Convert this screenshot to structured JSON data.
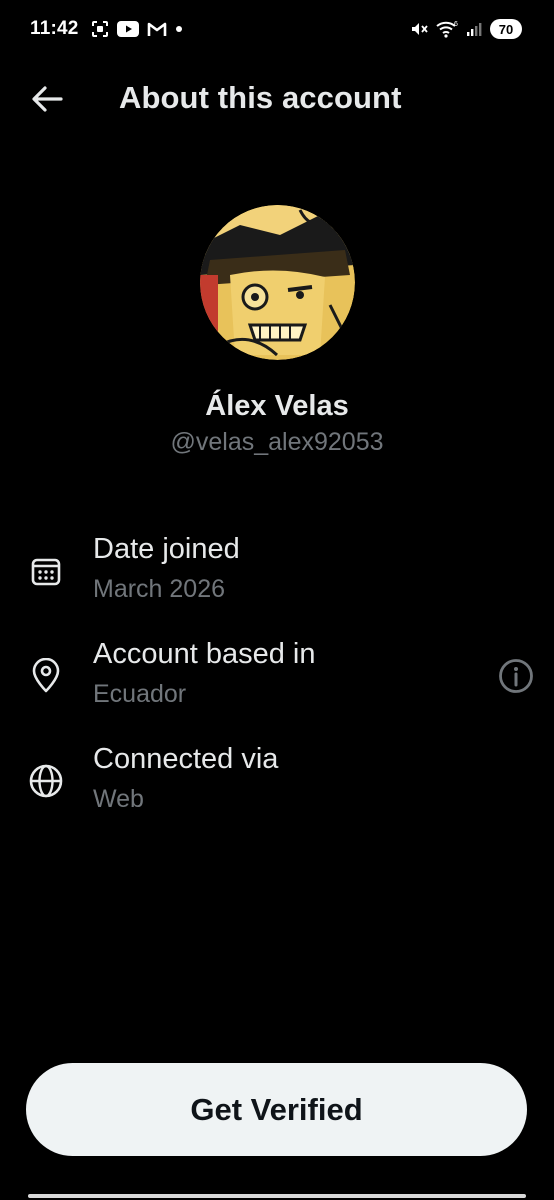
{
  "status_bar": {
    "time": "11:42",
    "battery": "70"
  },
  "header": {
    "title": "About this account",
    "back_icon": "arrow-left-icon"
  },
  "profile": {
    "display_name": "Álex Velas",
    "handle": "@velas_alex92053"
  },
  "info": {
    "date_joined": {
      "label": "Date joined",
      "value": "March 2026",
      "icon": "calendar-icon"
    },
    "account_based_in": {
      "label": "Account based in",
      "value": "Ecuador",
      "icon": "location-pin-icon",
      "info_icon": "info-icon"
    },
    "connected_via": {
      "label": "Connected via",
      "value": "Web",
      "icon": "globe-icon"
    }
  },
  "actions": {
    "get_verified": "Get Verified"
  },
  "colors": {
    "background": "#000000",
    "primary_text": "#e7e9ea",
    "secondary_text": "#71767b",
    "button_bg": "#eff3f4",
    "button_text": "#0f1419"
  }
}
